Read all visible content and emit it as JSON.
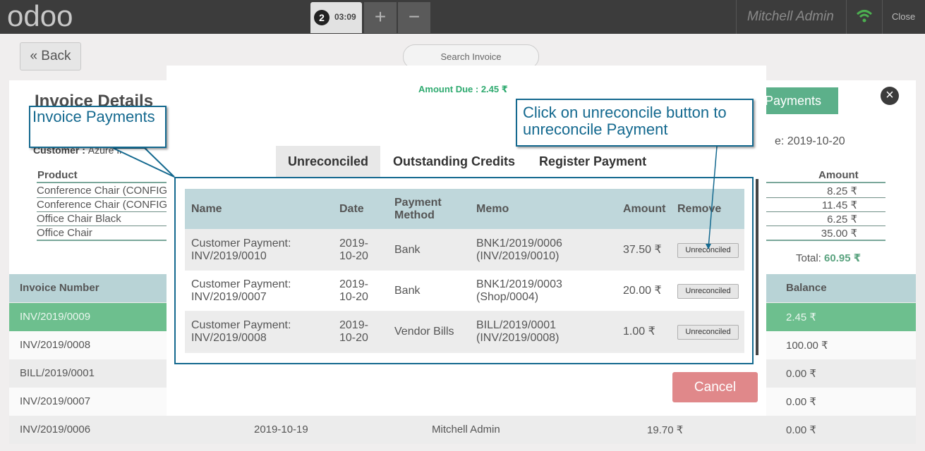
{
  "topbar": {
    "logo": "odoo",
    "order_number": "2",
    "order_time": "03:09",
    "add_icon": "+",
    "remove_icon": "−",
    "user": "Mitchell Admin",
    "wifi_icon": "wifi-icon",
    "close_label": "Close"
  },
  "screen": {
    "back_label": "Back",
    "search_placeholder": "Search Invoice",
    "invoice_title": "Invoice Details",
    "customer_label": "Customer :",
    "customer_value": "Azure Interior",
    "payments_button": "Payments",
    "date_text": "e: 2019-10-20",
    "product_header": "Product",
    "amount_header": "Amount",
    "products": [
      {
        "name": "Conference Chair (CONFIG",
        "amount": "8.25 ₹"
      },
      {
        "name": "Conference Chair (CONFIG",
        "amount": "11.45 ₹"
      },
      {
        "name": "Office Chair Black",
        "amount": "6.25 ₹"
      },
      {
        "name": "Office Chair",
        "amount": "35.00 ₹"
      }
    ],
    "total_label": "Total:",
    "total_value": "60.95 ₹",
    "list_header": {
      "invoice_number": "Invoice Number",
      "balance": "Balance"
    },
    "list_rows": [
      {
        "number": "INV/2019/0009",
        "date": "",
        "user": "",
        "amount": "",
        "balance": "2.45 ₹"
      },
      {
        "number": "INV/2019/0008",
        "date": "",
        "user": "",
        "amount": "",
        "balance": "100.00 ₹"
      },
      {
        "number": "BILL/2019/0001",
        "date": "",
        "user": "",
        "amount": "",
        "balance": "0.00 ₹"
      },
      {
        "number": "INV/2019/0007",
        "date": "",
        "user": "",
        "amount": "",
        "balance": "0.00 ₹"
      },
      {
        "number": "INV/2019/0006",
        "date": "2019-10-19",
        "user": "Mitchell Admin",
        "amount": "19.70 ₹",
        "balance": "0.00 ₹"
      }
    ]
  },
  "modal": {
    "amount_due": "Amount Due : 2.45 ₹",
    "tabs": [
      "Unreconciled",
      "Outstanding Credits",
      "Register Payment"
    ],
    "columns": {
      "name": "Name",
      "date": "Date",
      "method": "Payment Method",
      "memo": "Memo",
      "amount": "Amount",
      "remove": "Remove"
    },
    "rows": [
      {
        "name": "Customer Payment: INV/2019/0010",
        "date": "2019-10-20",
        "method": "Bank",
        "memo": "BNK1/2019/0006 (INV/2019/0010)",
        "amount": "37.50 ₹",
        "button": "Unreconciled"
      },
      {
        "name": "Customer Payment: INV/2019/0007",
        "date": "2019-10-20",
        "method": "Bank",
        "memo": "BNK1/2019/0003 (Shop/0004)",
        "amount": "20.00 ₹",
        "button": "Unreconciled"
      },
      {
        "name": "Customer Payment: INV/2019/0008",
        "date": "2019-10-20",
        "method": "Vendor Bills",
        "memo": "BILL/2019/0001 (INV/2019/0008)",
        "amount": "1.00 ₹",
        "button": "Unreconciled"
      }
    ],
    "cancel_label": "Cancel"
  },
  "annotations": {
    "invoice_payments": "Invoice Payments",
    "unreconcile_hint": "Click on unreconcile button to unreconcile Payment"
  },
  "colors": {
    "topbar": "#3c3c3c",
    "accent_green": "#5cb08a",
    "table_header": "#bfd7db",
    "cancel": "#e0888a",
    "callout": "#14698f"
  }
}
